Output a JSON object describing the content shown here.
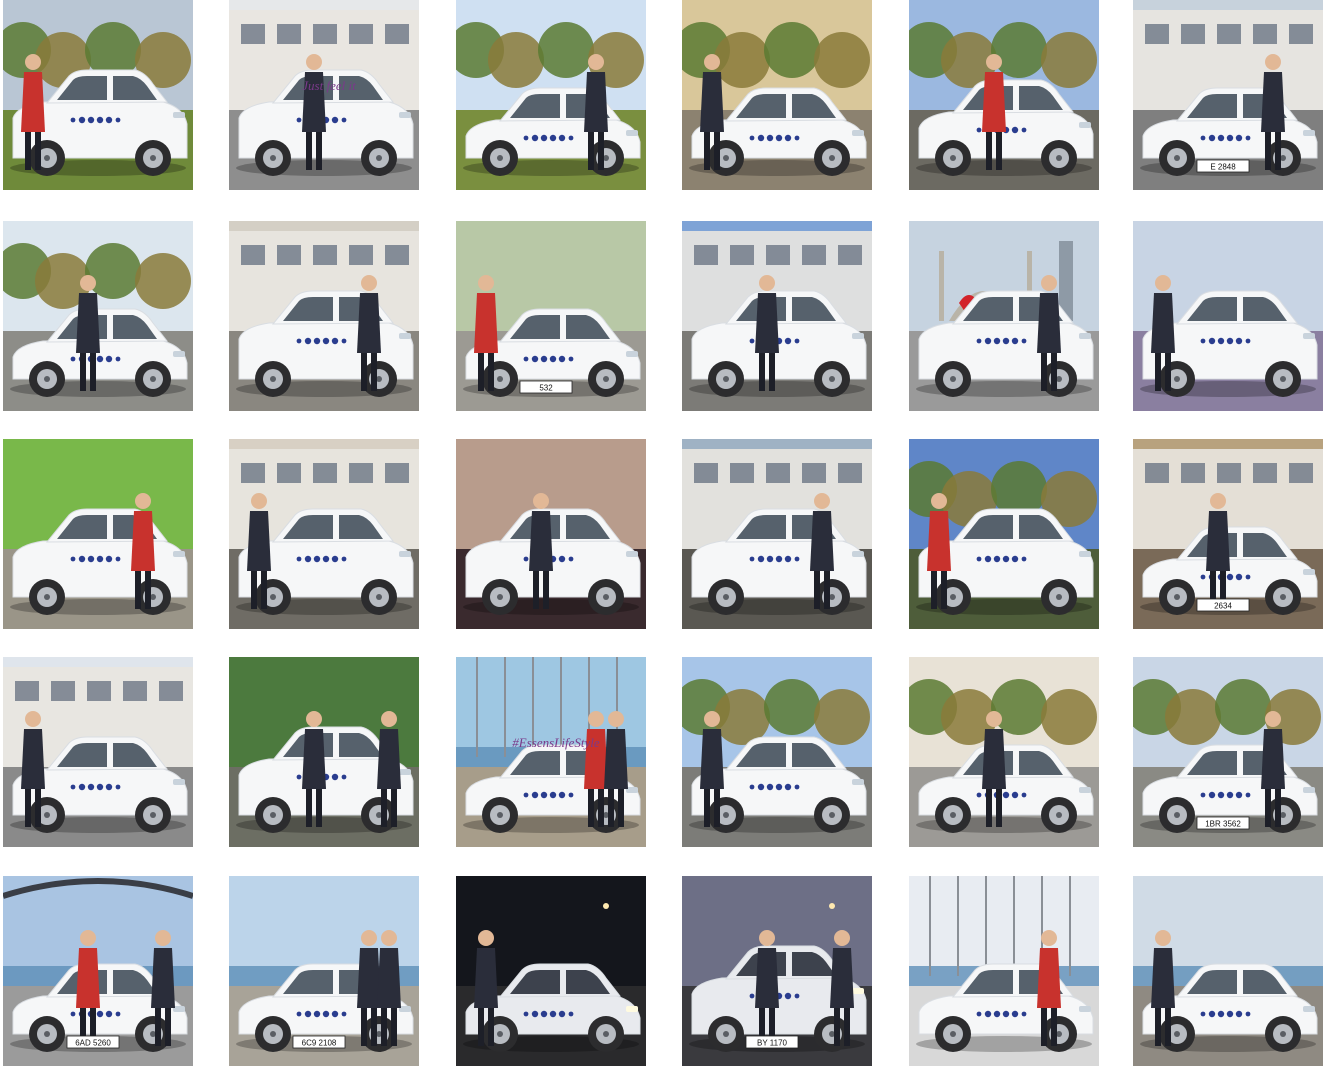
{
  "gallery": {
    "rows": [
      [
        {
          "scene": "field-trees",
          "sky": "#b9c6d4",
          "ground": "#6f8a3a",
          "car": "suv",
          "people": 1,
          "plate": "",
          "wall_text": ""
        },
        {
          "scene": "office-wall",
          "sky": "#e6e8ea",
          "ground": "#8e8e8e",
          "car": "suv",
          "people": 1,
          "plate": "",
          "wall_text": "Just feel it"
        },
        {
          "scene": "park",
          "sky": "#cfe0f2",
          "ground": "#7a8f3f",
          "car": "sedan",
          "people": 1,
          "plate": "",
          "wall_text": ""
        },
        {
          "scene": "autumn-street",
          "sky": "#d9c79a",
          "ground": "#8c8270",
          "car": "sedan",
          "people": 1,
          "plate": "",
          "wall_text": ""
        },
        {
          "scene": "autumn-trees",
          "sky": "#9bb8e0",
          "ground": "#6c6a62",
          "car": "wagon",
          "people": 1,
          "plate": "",
          "wall_text": ""
        },
        {
          "scene": "houses",
          "sky": "#c7d2dc",
          "ground": "#7f7f7f",
          "car": "sedan",
          "people": 1,
          "plate": "E 2848",
          "wall_text": ""
        }
      ],
      [
        {
          "scene": "sky-trees",
          "sky": "#dce6ee",
          "ground": "#8d8d88",
          "car": "sedan",
          "people": 1,
          "plate": "",
          "wall_text": ""
        },
        {
          "scene": "building",
          "sky": "#d4cfc5",
          "ground": "#8a8780",
          "car": "suv",
          "people": 1,
          "plate": "",
          "wall_text": ""
        },
        {
          "scene": "parking",
          "sky": "#b8c8a6",
          "ground": "#9c9a93",
          "car": "sedan",
          "people": 1,
          "plate": "532",
          "wall_text": ""
        },
        {
          "scene": "house",
          "sky": "#7ea3d6",
          "ground": "#7c7b77",
          "car": "suv",
          "people": 1,
          "plate": "",
          "wall_text": ""
        },
        {
          "scene": "mosque",
          "sky": "#c6d3e0",
          "ground": "#9a9a9a",
          "car": "suv",
          "people": 1,
          "plate": "",
          "wall_text": ""
        },
        {
          "scene": "closeup",
          "sky": "#c8d4e4",
          "ground": "#8a7fa0",
          "car": "suv",
          "people": 1,
          "plate": "",
          "wall_text": ""
        }
      ],
      [
        {
          "scene": "grass-hill",
          "sky": "#79b84a",
          "ground": "#9a9588",
          "car": "suv",
          "people": 1,
          "plate": "",
          "wall_text": ""
        },
        {
          "scene": "apartments",
          "sky": "#d8d0c4",
          "ground": "#6f6c65",
          "car": "suv",
          "people": 1,
          "plate": "",
          "wall_text": ""
        },
        {
          "scene": "closeup",
          "sky": "#b89c8c",
          "ground": "#3a2a2e",
          "car": "suv",
          "people": 1,
          "plate": "",
          "wall_text": ""
        },
        {
          "scene": "carport",
          "sky": "#9fb2c4",
          "ground": "#5a5852",
          "car": "suv",
          "people": 1,
          "plate": "",
          "wall_text": ""
        },
        {
          "scene": "blue-sky",
          "sky": "#5f86c8",
          "ground": "#4e5d3a",
          "car": "suv",
          "people": 1,
          "plate": "",
          "wall_text": ""
        },
        {
          "scene": "town",
          "sky": "#b8a27e",
          "ground": "#7a6a58",
          "car": "sedan",
          "people": 1,
          "plate": "2634",
          "wall_text": ""
        }
      ],
      [
        {
          "scene": "garage",
          "sky": "#dfe5ec",
          "ground": "#8a8a8a",
          "car": "wagon",
          "people": 1,
          "plate": "",
          "wall_text": ""
        },
        {
          "scene": "jump-grass",
          "sky": "#4c7a3e",
          "ground": "#6c6e63",
          "car": "suv",
          "people": 2,
          "plate": "",
          "wall_text": ""
        },
        {
          "scene": "harbor",
          "sky": "#9ec7e2",
          "ground": "#a79d8a",
          "car": "sedan",
          "people": 2,
          "plate": "",
          "wall_text": "#EssensLifeStyle"
        },
        {
          "scene": "hedge",
          "sky": "#a7c5e8",
          "ground": "#7c7c78",
          "car": "wagon",
          "people": 1,
          "plate": "",
          "wall_text": ""
        },
        {
          "scene": "street-post",
          "sky": "#e8e2d6",
          "ground": "#9c9a96",
          "car": "sedan",
          "people": 1,
          "plate": "",
          "wall_text": ""
        },
        {
          "scene": "lakeside",
          "sky": "#c9d6e6",
          "ground": "#8a8a84",
          "car": "sedan",
          "people": 1,
          "plate": "1BR 3562",
          "wall_text": ""
        }
      ],
      [
        {
          "scene": "bridge",
          "sky": "#a9c4e2",
          "ground": "#9b9b9b",
          "car": "sedan",
          "people": 2,
          "plate": "6AD 5260",
          "wall_text": ""
        },
        {
          "scene": "promenade",
          "sky": "#bcd4ea",
          "ground": "#a8a398",
          "car": "coupe",
          "people": 2,
          "plate": "6C9 2108",
          "wall_text": ""
        },
        {
          "scene": "night",
          "sky": "#14161c",
          "ground": "#2a2a2c",
          "car": "sedan",
          "people": 1,
          "plate": "",
          "wall_text": ""
        },
        {
          "scene": "dusk",
          "sky": "#6d6f86",
          "ground": "#3a3a3e",
          "car": "suv",
          "people": 2,
          "plate": "BY 1170",
          "wall_text": ""
        },
        {
          "scene": "marina",
          "sky": "#e8ecf2",
          "ground": "#d8d8d8",
          "car": "sedan",
          "people": 1,
          "plate": "",
          "wall_text": ""
        },
        {
          "scene": "seafront",
          "sky": "#d0dbe6",
          "ground": "#8f8a82",
          "car": "sedan",
          "people": 1,
          "plate": "",
          "wall_text": ""
        }
      ]
    ],
    "colors": {
      "car_body": "#f6f7f8",
      "car_shadow": "#d9dde2",
      "window": "#3a4654",
      "decal": "#2a3d8f",
      "wheel": "#2c2c2e",
      "rim": "#b8bcc2",
      "person_dark": "#2a2d3a",
      "person_red": "#c8322d",
      "skin": "#e2b896"
    }
  }
}
